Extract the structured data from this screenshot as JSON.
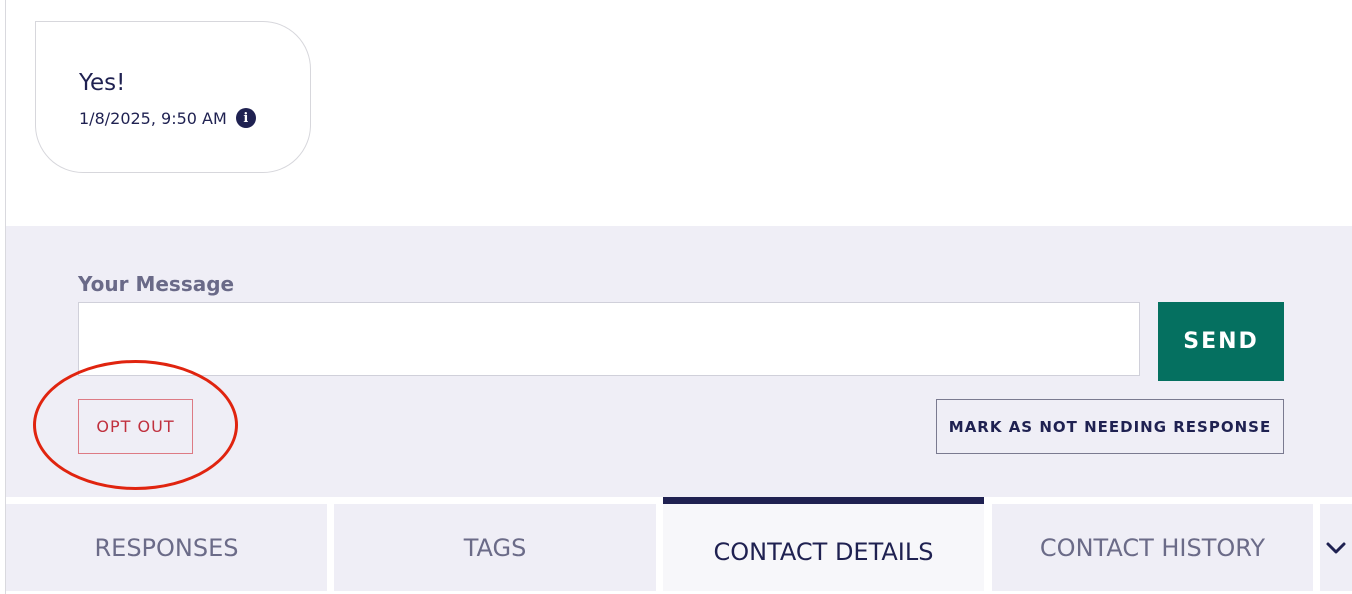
{
  "message": {
    "text": "Yes!",
    "timestamp": "1/8/2025, 9:50 AM",
    "info_icon": "i"
  },
  "composer": {
    "label": "Your Message",
    "input_value": "",
    "input_placeholder": "",
    "send_label": "SEND",
    "opt_out_label": "OPT OUT",
    "mark_label": "MARK AS NOT NEEDING RESPONSE"
  },
  "tabs": [
    {
      "label": "RESPONSES"
    },
    {
      "label": "TAGS"
    },
    {
      "label": "CONTACT DETAILS"
    },
    {
      "label": "CONTACT HISTORY"
    }
  ],
  "active_tab": "CONTACT DETAILS",
  "colors": {
    "accent": "#1f2151",
    "send": "#057060",
    "opt_out": "#c0303e",
    "highlight": "#e0240f"
  },
  "icons": {
    "info": "info-icon",
    "more_tabs": "chevron-down-icon"
  }
}
